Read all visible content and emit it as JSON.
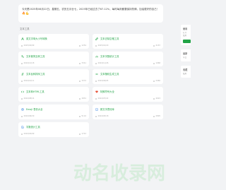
{
  "banner": {
    "text": "今天是2025年08月22日，星期五，农历五月廿七，2025年已经过去了67.12%，每时每刻都要保持热情，加油更好的自己！",
    "icons": "🔥💪"
  },
  "section": {
    "title": "文本工具"
  },
  "cards": [
    {
      "title": "英文字母大小写转换",
      "date": "2025/02/09",
      "views": "1254",
      "icon": "font-icon",
      "color": "#22a447"
    },
    {
      "title": "文本去除空格工具",
      "date": "2025/01/20",
      "views": "2187",
      "icon": "edit-icon",
      "color": "#22a447"
    },
    {
      "title": "文本繁简互转工具",
      "date": "2024/12/18",
      "views": "3341",
      "icon": "translate-icon",
      "color": "#22a447"
    },
    {
      "title": "文本字数统计工具",
      "date": "2024/11/26",
      "views": "1968",
      "icon": "count-icon",
      "color": "#22a447"
    },
    {
      "title": "文本反转排序工具",
      "date": "2024/10/11",
      "views": "1572",
      "icon": "sort-icon",
      "color": "#22a447"
    },
    {
      "title": "文本随机生成工具",
      "date": "2024/09/05",
      "views": "2460",
      "icon": "random-icon",
      "color": "#22a447"
    },
    {
      "title": "文本转HTML工具",
      "date": "2024/08/14",
      "views": "1831",
      "icon": "code-icon",
      "color": "#22a447"
    },
    {
      "title": "特殊符号大全",
      "date": "2024/07/22",
      "views": "4023",
      "icon": "heart-icon",
      "color": "#e8553d"
    },
    {
      "title": "Emoji 表情大全",
      "date": "2024/06/30",
      "views": "5110",
      "icon": "emoji-icon",
      "color": "#2f7fe0"
    },
    {
      "title": "颜文字表情库",
      "date": "2024/05/18",
      "views": "2895",
      "icon": "face-icon",
      "color": "#2f7fe0"
    },
    {
      "title": "字数统计工具",
      "date": "2024/04/09",
      "views": "1743",
      "icon": "doc-icon",
      "color": "#2f7fe0"
    }
  ],
  "sidebar": {
    "box1": {
      "heading": "使用",
      "lines": [
        "打开",
        "使用"
      ]
    },
    "box2": {
      "heading": "最新",
      "lines": [
        "今日"
      ]
    },
    "box3": {
      "heading": "收藏",
      "lines": [
        "使用"
      ]
    }
  },
  "watermark": {
    "text": "动名收录网",
    "color": "#d8eddd"
  }
}
